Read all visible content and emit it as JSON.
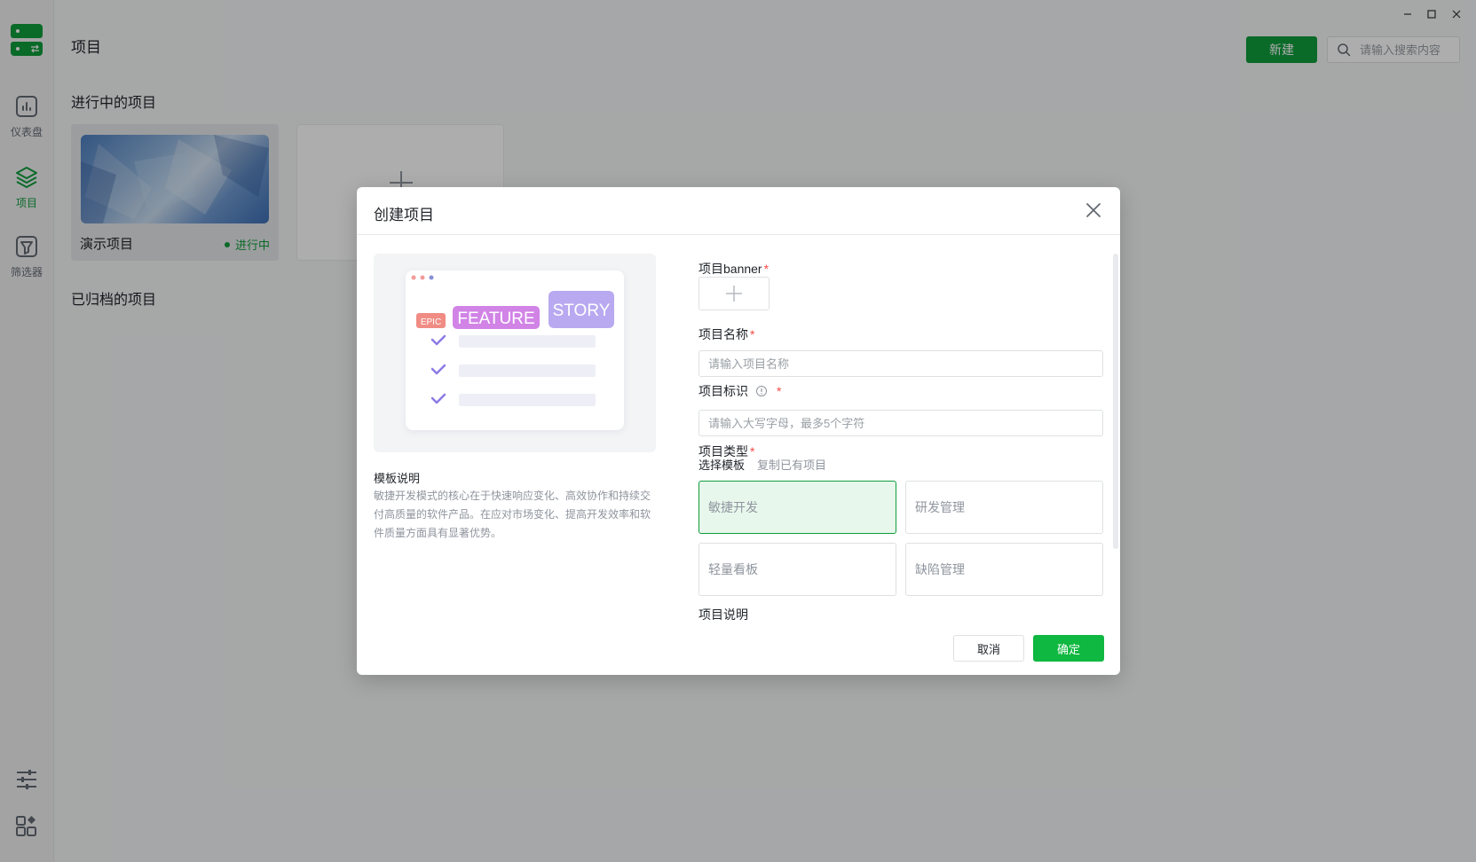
{
  "sidebar": {
    "items": [
      {
        "label": "仪表盘",
        "icon": "dashboard-icon"
      },
      {
        "label": "项目",
        "icon": "layers-icon",
        "active": true
      },
      {
        "label": "筛选器",
        "icon": "filter-icon"
      }
    ],
    "bottom_icons": [
      "sliders-icon",
      "apps-icon"
    ]
  },
  "header": {
    "title": "项目",
    "new_button": "新建",
    "search_placeholder": "请输入搜索内容"
  },
  "window_controls": [
    "minimize-icon",
    "maximize-icon",
    "close-icon"
  ],
  "sections": {
    "active_title": "进行中的项目",
    "archived_title": "已归档的项目"
  },
  "projects": [
    {
      "name": "演示项目",
      "status": "进行中"
    }
  ],
  "modal": {
    "title": "创建项目",
    "illustration": {
      "tags": [
        "EPIC",
        "FEATURE",
        "STORY"
      ]
    },
    "template_desc_title": "模板说明",
    "template_desc_body": "敏捷开发模式的核心在于快速响应变化、高效协作和持续交付高质量的软件产品。在应对市场变化、提高开发效率和软件质量方面具有显著优势。",
    "form": {
      "banner_label": "项目banner",
      "name_label": "项目名称",
      "name_placeholder": "请输入项目名称",
      "key_label": "项目标识",
      "key_placeholder": "请输入大写字母，最多5个字符",
      "type_label": "项目类型",
      "type_tabs": [
        "选择模板",
        "复制已有项目"
      ],
      "templates": [
        {
          "label": "敏捷开发",
          "selected": true
        },
        {
          "label": "研发管理",
          "selected": false
        },
        {
          "label": "轻量看板",
          "selected": false
        },
        {
          "label": "缺陷管理",
          "selected": false
        }
      ],
      "desc_label": "项目说明",
      "required_mark": "*"
    },
    "cancel": "取消",
    "confirm": "确定"
  },
  "colors": {
    "brand": "#0f9d3b",
    "selected_bg": "#e8f7ec",
    "required": "#f54a45"
  }
}
